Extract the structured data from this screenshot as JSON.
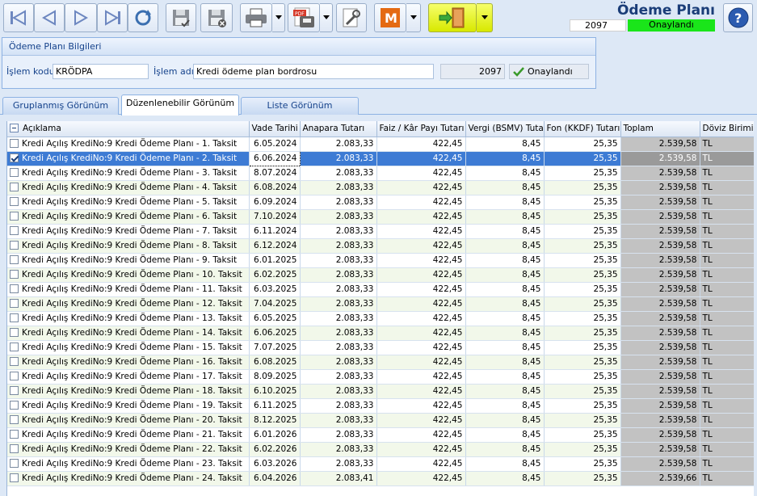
{
  "header": {
    "title": "Ödeme Planı",
    "code": "2097",
    "status": "Onaylandı",
    "status_color": "#1ae51a",
    "toolbar_icons": [
      "first-record-icon",
      "previous-record-icon",
      "next-record-icon",
      "last-record-icon",
      "refresh-icon",
      "save-icon",
      "delete-save-icon",
      "print-icon",
      "pdf-icon",
      "tools-icon",
      "m-icon",
      "exit-door-icon",
      "help-icon"
    ]
  },
  "info_panel": {
    "title": "Ödeme Planı Bilgileri",
    "islem_kodu_label": "İşlem kodu",
    "islem_kodu_value": "KRÖDPA",
    "islem_adi_label": "İşlem adı",
    "islem_adi_value": "Kredi ödeme plan bordrosu",
    "number": "2097",
    "approved_label": "Onaylandı"
  },
  "tabs": [
    {
      "label": "Gruplanmış Görünüm",
      "active": false
    },
    {
      "label": "Düzenlenebilir Görünüm",
      "active": true
    },
    {
      "label": "Liste Görünüm",
      "active": false
    }
  ],
  "grid": {
    "columns": [
      "Açıklama",
      "Vade Tarihi",
      "Anapara Tutarı",
      "Faiz / Kâr Payı Tutarı",
      "Vergi (BSMV) Tutarı",
      "Fon (KKDF) Tutarı",
      "Toplam",
      "Döviz Birimi"
    ],
    "rows": [
      {
        "checked": false,
        "desc": "Kredi Açılış KrediNo:9 Kredi Ödeme Planı - 1. Taksit",
        "date": "6.05.2024",
        "anapara": "2.083,33",
        "faiz": "422,45",
        "vergi": "8,45",
        "fon": "25,35",
        "toplam": "2.539,58",
        "doviz": "TL"
      },
      {
        "checked": true,
        "desc": "Kredi Açılış KrediNo:9 Kredi Ödeme Planı - 2. Taksit",
        "date": "6.06.2024",
        "anapara": "2.083,33",
        "faiz": "422,45",
        "vergi": "8,45",
        "fon": "25,35",
        "toplam": "2.539,58",
        "doviz": "TL"
      },
      {
        "checked": false,
        "desc": "Kredi Açılış KrediNo:9 Kredi Ödeme Planı - 3. Taksit",
        "date": "8.07.2024",
        "anapara": "2.083,33",
        "faiz": "422,45",
        "vergi": "8,45",
        "fon": "25,35",
        "toplam": "2.539,58",
        "doviz": "TL"
      },
      {
        "checked": false,
        "desc": "Kredi Açılış KrediNo:9 Kredi Ödeme Planı - 4. Taksit",
        "date": "6.08.2024",
        "anapara": "2.083,33",
        "faiz": "422,45",
        "vergi": "8,45",
        "fon": "25,35",
        "toplam": "2.539,58",
        "doviz": "TL"
      },
      {
        "checked": false,
        "desc": "Kredi Açılış KrediNo:9 Kredi Ödeme Planı - 5. Taksit",
        "date": "6.09.2024",
        "anapara": "2.083,33",
        "faiz": "422,45",
        "vergi": "8,45",
        "fon": "25,35",
        "toplam": "2.539,58",
        "doviz": "TL"
      },
      {
        "checked": false,
        "desc": "Kredi Açılış KrediNo:9 Kredi Ödeme Planı - 6. Taksit",
        "date": "7.10.2024",
        "anapara": "2.083,33",
        "faiz": "422,45",
        "vergi": "8,45",
        "fon": "25,35",
        "toplam": "2.539,58",
        "doviz": "TL"
      },
      {
        "checked": false,
        "desc": "Kredi Açılış KrediNo:9 Kredi Ödeme Planı - 7. Taksit",
        "date": "6.11.2024",
        "anapara": "2.083,33",
        "faiz": "422,45",
        "vergi": "8,45",
        "fon": "25,35",
        "toplam": "2.539,58",
        "doviz": "TL"
      },
      {
        "checked": false,
        "desc": "Kredi Açılış KrediNo:9 Kredi Ödeme Planı - 8. Taksit",
        "date": "6.12.2024",
        "anapara": "2.083,33",
        "faiz": "422,45",
        "vergi": "8,45",
        "fon": "25,35",
        "toplam": "2.539,58",
        "doviz": "TL"
      },
      {
        "checked": false,
        "desc": "Kredi Açılış KrediNo:9 Kredi Ödeme Planı - 9. Taksit",
        "date": "6.01.2025",
        "anapara": "2.083,33",
        "faiz": "422,45",
        "vergi": "8,45",
        "fon": "25,35",
        "toplam": "2.539,58",
        "doviz": "TL"
      },
      {
        "checked": false,
        "desc": "Kredi Açılış KrediNo:9 Kredi Ödeme Planı - 10. Taksit",
        "date": "6.02.2025",
        "anapara": "2.083,33",
        "faiz": "422,45",
        "vergi": "8,45",
        "fon": "25,35",
        "toplam": "2.539,58",
        "doviz": "TL"
      },
      {
        "checked": false,
        "desc": "Kredi Açılış KrediNo:9 Kredi Ödeme Planı - 11. Taksit",
        "date": "6.03.2025",
        "anapara": "2.083,33",
        "faiz": "422,45",
        "vergi": "8,45",
        "fon": "25,35",
        "toplam": "2.539,58",
        "doviz": "TL"
      },
      {
        "checked": false,
        "desc": "Kredi Açılış KrediNo:9 Kredi Ödeme Planı - 12. Taksit",
        "date": "7.04.2025",
        "anapara": "2.083,33",
        "faiz": "422,45",
        "vergi": "8,45",
        "fon": "25,35",
        "toplam": "2.539,58",
        "doviz": "TL"
      },
      {
        "checked": false,
        "desc": "Kredi Açılış KrediNo:9 Kredi Ödeme Planı - 13. Taksit",
        "date": "6.05.2025",
        "anapara": "2.083,33",
        "faiz": "422,45",
        "vergi": "8,45",
        "fon": "25,35",
        "toplam": "2.539,58",
        "doviz": "TL"
      },
      {
        "checked": false,
        "desc": "Kredi Açılış KrediNo:9 Kredi Ödeme Planı - 14. Taksit",
        "date": "6.06.2025",
        "anapara": "2.083,33",
        "faiz": "422,45",
        "vergi": "8,45",
        "fon": "25,35",
        "toplam": "2.539,58",
        "doviz": "TL"
      },
      {
        "checked": false,
        "desc": "Kredi Açılış KrediNo:9 Kredi Ödeme Planı - 15. Taksit",
        "date": "7.07.2025",
        "anapara": "2.083,33",
        "faiz": "422,45",
        "vergi": "8,45",
        "fon": "25,35",
        "toplam": "2.539,58",
        "doviz": "TL"
      },
      {
        "checked": false,
        "desc": "Kredi Açılış KrediNo:9 Kredi Ödeme Planı - 16. Taksit",
        "date": "6.08.2025",
        "anapara": "2.083,33",
        "faiz": "422,45",
        "vergi": "8,45",
        "fon": "25,35",
        "toplam": "2.539,58",
        "doviz": "TL"
      },
      {
        "checked": false,
        "desc": "Kredi Açılış KrediNo:9 Kredi Ödeme Planı - 17. Taksit",
        "date": "8.09.2025",
        "anapara": "2.083,33",
        "faiz": "422,45",
        "vergi": "8,45",
        "fon": "25,35",
        "toplam": "2.539,58",
        "doviz": "TL"
      },
      {
        "checked": false,
        "desc": "Kredi Açılış KrediNo:9 Kredi Ödeme Planı - 18. Taksit",
        "date": "6.10.2025",
        "anapara": "2.083,33",
        "faiz": "422,45",
        "vergi": "8,45",
        "fon": "25,35",
        "toplam": "2.539,58",
        "doviz": "TL"
      },
      {
        "checked": false,
        "desc": "Kredi Açılış KrediNo:9 Kredi Ödeme Planı - 19. Taksit",
        "date": "6.11.2025",
        "anapara": "2.083,33",
        "faiz": "422,45",
        "vergi": "8,45",
        "fon": "25,35",
        "toplam": "2.539,58",
        "doviz": "TL"
      },
      {
        "checked": false,
        "desc": "Kredi Açılış KrediNo:9 Kredi Ödeme Planı - 20. Taksit",
        "date": "8.12.2025",
        "anapara": "2.083,33",
        "faiz": "422,45",
        "vergi": "8,45",
        "fon": "25,35",
        "toplam": "2.539,58",
        "doviz": "TL"
      },
      {
        "checked": false,
        "desc": "Kredi Açılış KrediNo:9 Kredi Ödeme Planı - 21. Taksit",
        "date": "6.01.2026",
        "anapara": "2.083,33",
        "faiz": "422,45",
        "vergi": "8,45",
        "fon": "25,35",
        "toplam": "2.539,58",
        "doviz": "TL"
      },
      {
        "checked": false,
        "desc": "Kredi Açılış KrediNo:9 Kredi Ödeme Planı - 22. Taksit",
        "date": "6.02.2026",
        "anapara": "2.083,33",
        "faiz": "422,45",
        "vergi": "8,45",
        "fon": "25,35",
        "toplam": "2.539,58",
        "doviz": "TL"
      },
      {
        "checked": false,
        "desc": "Kredi Açılış KrediNo:9 Kredi Ödeme Planı - 23. Taksit",
        "date": "6.03.2026",
        "anapara": "2.083,33",
        "faiz": "422,45",
        "vergi": "8,45",
        "fon": "25,35",
        "toplam": "2.539,58",
        "doviz": "TL"
      },
      {
        "checked": false,
        "desc": "Kredi Açılış KrediNo:9 Kredi Ödeme Planı - 24. Taksit",
        "date": "6.04.2026",
        "anapara": "2.083,41",
        "faiz": "422,45",
        "vergi": "8,45",
        "fon": "25,35",
        "toplam": "2.539,66",
        "doviz": "TL"
      }
    ]
  }
}
